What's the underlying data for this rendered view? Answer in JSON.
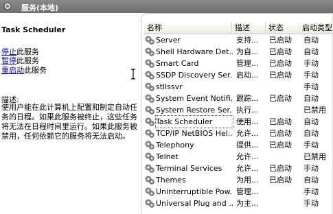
{
  "window": {
    "title": "服务(本地)"
  },
  "detail": {
    "service_name": "Task Scheduler",
    "actions": [
      {
        "link": "停止",
        "suffix": "此服务"
      },
      {
        "link": "暂停",
        "suffix": "此服务"
      },
      {
        "link": "重启动",
        "suffix": "此服务"
      }
    ],
    "description_label": "描述:",
    "description": "使用户能在此计算机上配置和制定自动任务的日程。如果此服务被终止，这些任务将无法在日程时间里运行。如果此服务被禁用，任何依赖它的服务将无法启动。"
  },
  "columns": [
    "名称",
    "描述",
    "状态",
    "启动类型"
  ],
  "services": [
    {
      "name": "Server",
      "desc": "支持...",
      "status": "已启动",
      "startup": "自动"
    },
    {
      "name": "Shell Hardware Det...",
      "desc": "为自...",
      "status": "已启动",
      "startup": "自动"
    },
    {
      "name": "Smart Card",
      "desc": "管理...",
      "status": "已启动",
      "startup": "手动"
    },
    {
      "name": "SSDP Discovery Ser...",
      "desc": "启动...",
      "status": "已启动",
      "startup": "手动"
    },
    {
      "name": "stllssvr",
      "desc": "",
      "status": "",
      "startup": "手动"
    },
    {
      "name": "System Event Notifi...",
      "desc": "跟踪...",
      "status": "已启动",
      "startup": "自动"
    },
    {
      "name": "System Restore Ser...",
      "desc": "执行...",
      "status": "",
      "startup": "已禁用"
    },
    {
      "name": "Task Scheduler",
      "desc": "使用...",
      "status": "已启动",
      "startup": "自动",
      "selected": true
    },
    {
      "name": "TCP/IP NetBIOS Hel...",
      "desc": "允许...",
      "status": "已启动",
      "startup": "自动"
    },
    {
      "name": "Telephony",
      "desc": "提供...",
      "status": "已启动",
      "startup": "手动"
    },
    {
      "name": "Telnet",
      "desc": "允许...",
      "status": "",
      "startup": "已禁用"
    },
    {
      "name": "Terminal Services",
      "desc": "允许...",
      "status": "已启动",
      "startup": "手动"
    },
    {
      "name": "Themes",
      "desc": "为用...",
      "status": "已启动",
      "startup": "自动"
    },
    {
      "name": "Uninterruptible Pow...",
      "desc": "管理...",
      "status": "",
      "startup": "手动"
    },
    {
      "name": "Universal Plug and ...",
      "desc": "为主...",
      "status": "",
      "startup": "手动"
    }
  ],
  "colors": {
    "link": "#0000cc",
    "titlebar": "#7d7d7d",
    "gear": "#8a8a8a"
  }
}
